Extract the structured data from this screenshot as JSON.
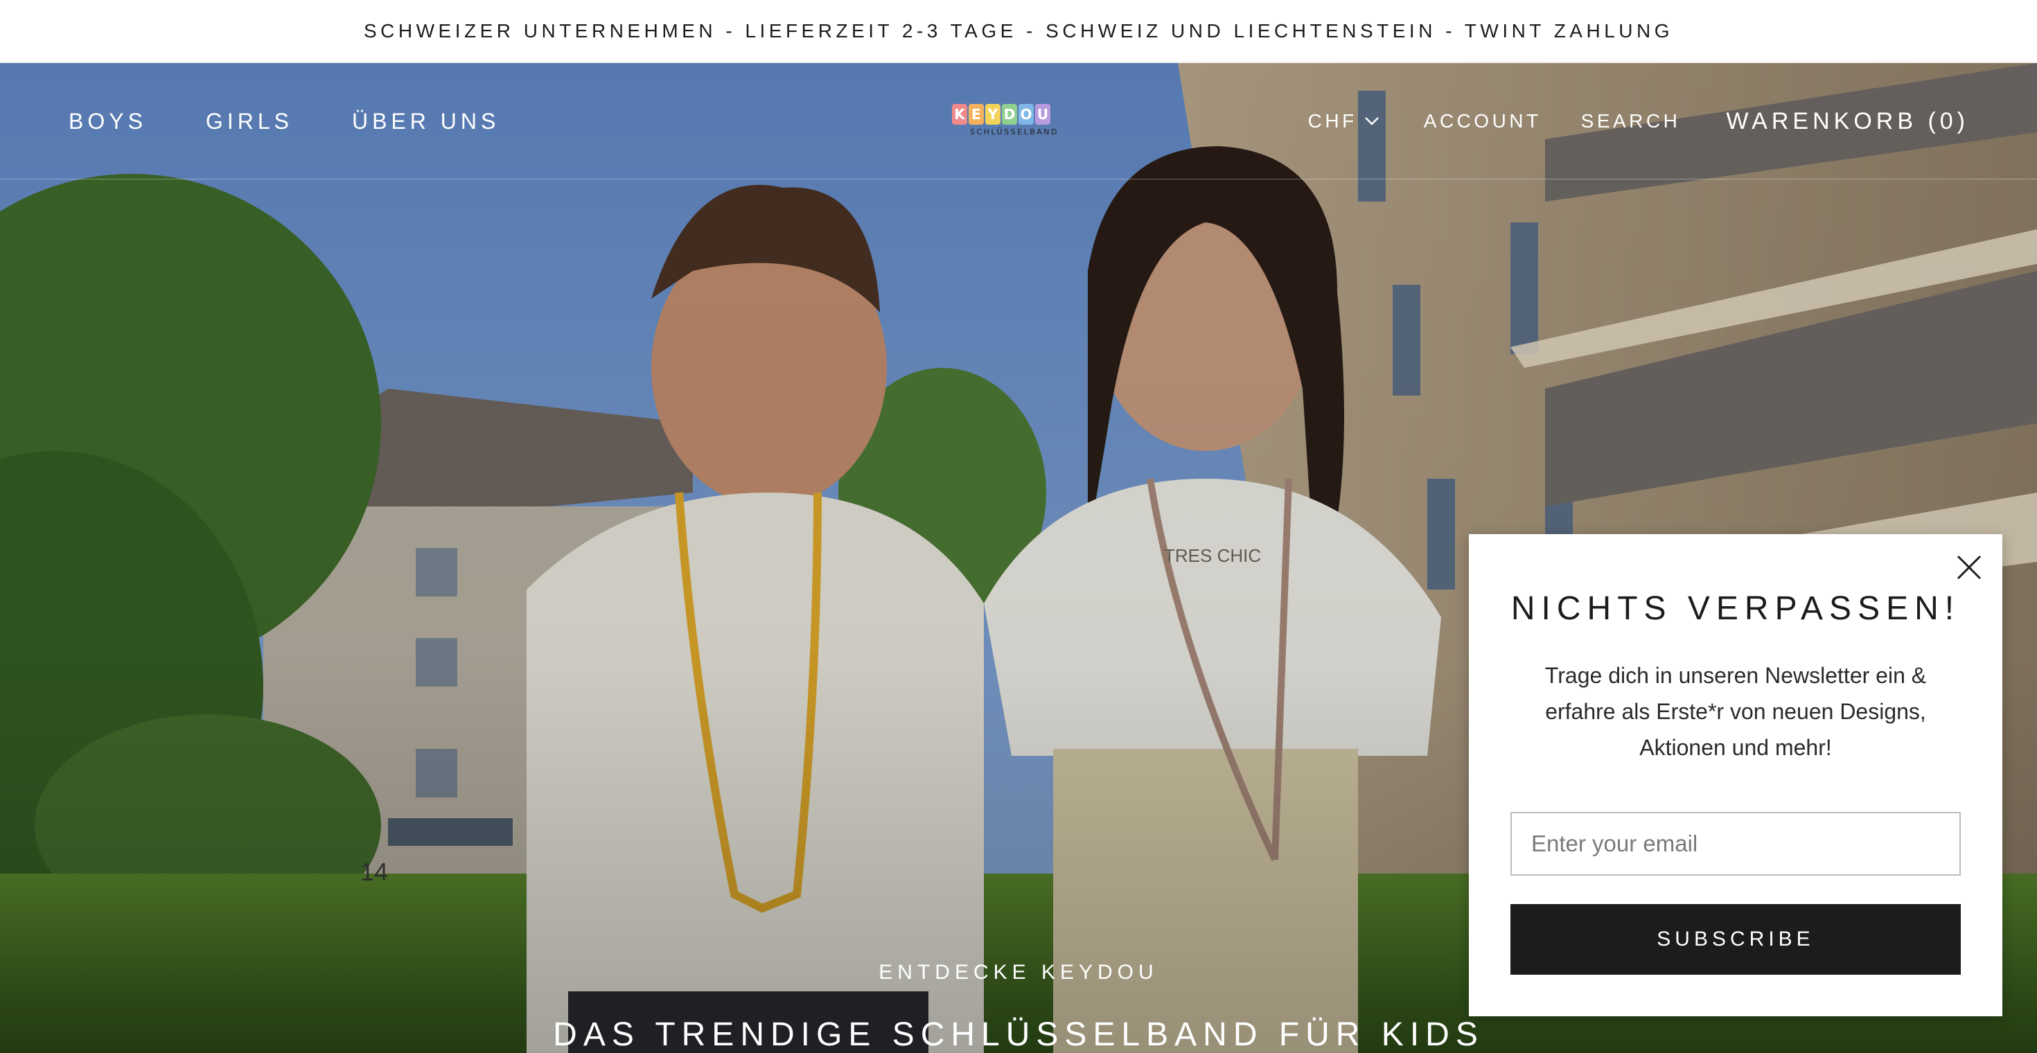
{
  "announcement": {
    "text": "SCHWEIZER UNTERNEHMEN - LIEFERZEIT 2-3 TAGE - SCHWEIZ UND LIECHTENSTEIN - TWINT ZAHLUNG"
  },
  "header": {
    "nav_left": [
      "BOYS",
      "GIRLS",
      "ÜBER UNS"
    ],
    "logo": {
      "letters": [
        "K",
        "E",
        "Y",
        "D",
        "O",
        "U"
      ],
      "subtitle": "SCHLÜSSELBAND"
    },
    "currency": "CHF",
    "account": "ACCOUNT",
    "search": "SEARCH",
    "cart": "WARENKORB (0)"
  },
  "hero": {
    "kicker": "ENTDECKE KEYDOU",
    "title": "DAS TRENDIGE SCHLÜSSELBAND FÜR KIDS",
    "shirt_print": "TRES CHIC",
    "house_number": "14"
  },
  "popup": {
    "title": "NICHTS VERPASSEN!",
    "text": "Trage dich in unseren Newsletter ein & erfahre als Erste*r von neuen Designs, Aktionen und mehr!",
    "email_placeholder": "Enter your email",
    "button": "SUBSCRIBE"
  },
  "colors": {
    "logo_letters": [
      "#ef8a8a",
      "#f5b25c",
      "#f2d35b",
      "#8fd08f",
      "#7fb8e8",
      "#b99be0"
    ],
    "button_bg": "#1c1c1c"
  }
}
